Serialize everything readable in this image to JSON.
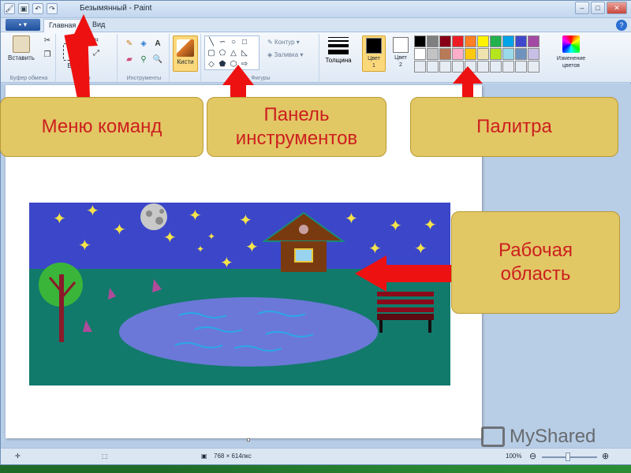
{
  "window": {
    "title": "Безымянный - Paint",
    "controls": {
      "minimize": "–",
      "maximize": "□",
      "close": "✕"
    }
  },
  "ribbon_tabs": {
    "app_menu": "▪ ▾",
    "home": "Главная",
    "view": "Вид",
    "help": "?"
  },
  "ribbon": {
    "clipboard": {
      "paste_label": "Вставить",
      "group_label": "Буфер обмена"
    },
    "image": {
      "select_label": "Вы",
      "group_label": "Из"
    },
    "tools": {
      "group_label": "Инструменты"
    },
    "brushes": {
      "label": "Кисти"
    },
    "shapes": {
      "outline_label": "Контур",
      "fill_label": "Заливка",
      "group_label": "Фигуры"
    },
    "size": {
      "label": "Толщина"
    },
    "color1": {
      "label": "Цвет\n1",
      "value": "#000000"
    },
    "color2": {
      "label": "Цвет\n2",
      "value": "#ffffff"
    },
    "edit_colors": {
      "label": "Изменение цветов"
    },
    "palette": [
      "#000000",
      "#7f7f7f",
      "#880015",
      "#ed1c24",
      "#ff7f27",
      "#fff200",
      "#22b14c",
      "#00a2e8",
      "#3f48cc",
      "#a349a4",
      "#ffffff",
      "#c3c3c3",
      "#b97a57",
      "#ffaec9",
      "#ffc90e",
      "#efe4b0",
      "#b5e61d",
      "#99d9ea",
      "#7092be",
      "#c8bfe7",
      "#e6ecf4",
      "#e6ecf4",
      "#e6ecf4",
      "#e6ecf4",
      "#e6ecf4",
      "#e6ecf4",
      "#e6ecf4",
      "#e6ecf4",
      "#e6ecf4",
      "#e6ecf4"
    ]
  },
  "status": {
    "dimensions": "768 × 614пкс",
    "zoom": "100%"
  },
  "callouts": {
    "command_menu": "Меню команд",
    "tools_panel": "Панель инструментов",
    "palette": "Палитра",
    "workspace": "Рабочая область"
  },
  "watermark": "MyShared",
  "colors": {
    "callout_bg": "#e2c765",
    "callout_text": "#cc1f1f",
    "arrow": "#ee1111",
    "sky": "#3b46c9",
    "ground": "#127a6b",
    "lake": "#6b78d8"
  }
}
